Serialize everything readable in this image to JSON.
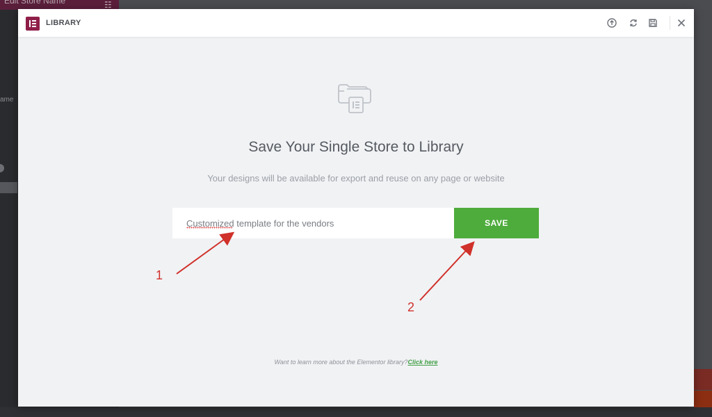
{
  "background": {
    "left_panel_title": "Edit Store Name",
    "left_panel_label": "ame"
  },
  "modal": {
    "title": "LIBRARY",
    "header_icons": [
      "info-upload-icon",
      "sync-icon",
      "save-icon",
      "close-icon"
    ]
  },
  "content": {
    "headline": "Save Your Single Store to Library",
    "subline": "Your designs will be available for export and reuse on any page or website",
    "input_value": "Customized template for the vendors",
    "save_label": "SAVE",
    "footer_text": "Want to learn more about the Elementor library?",
    "footer_link": "Click here"
  },
  "annotations": {
    "marker_1": "1",
    "marker_2": "2"
  },
  "colors": {
    "accent_green": "#4eac3c",
    "logo": "#8f1f48",
    "annotation_red": "#d0312a"
  }
}
